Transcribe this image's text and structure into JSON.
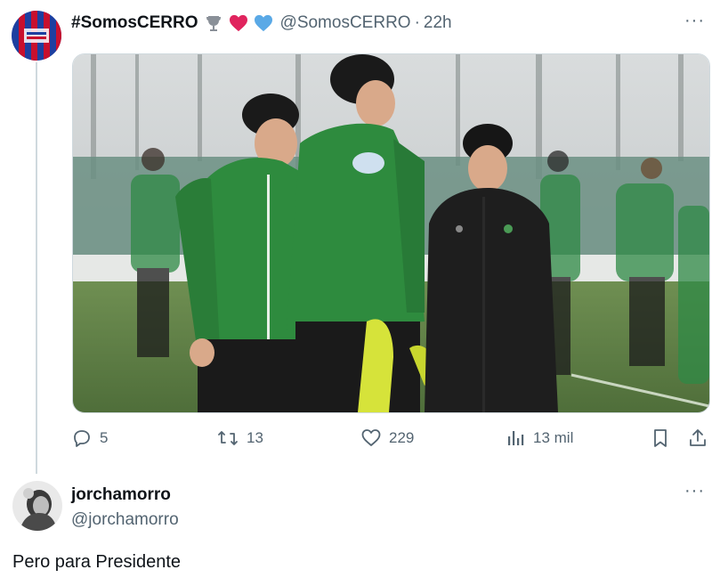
{
  "tweet": {
    "author_name": "#SomosCERRO",
    "author_handle": "@SomosCERRO",
    "separator": "·",
    "time_ago": "22h",
    "emojis": [
      "trophy-icon",
      "red-heart-icon",
      "blue-heart-icon"
    ],
    "stats": {
      "replies": "5",
      "retweets": "13",
      "likes": "229",
      "views": "13 mil"
    }
  },
  "reply": {
    "author_name": "jorchamorro",
    "author_handle": "@jorchamorro",
    "text": "Pero para Presidente"
  },
  "more_label": "···",
  "colors": {
    "text_primary": "#0f1419",
    "text_secondary": "#536471",
    "thread_line": "#cfd9de",
    "jersey_green": "#2e8b3e",
    "cerro_blue": "#1d3fa0",
    "cerro_red": "#c8102e"
  }
}
